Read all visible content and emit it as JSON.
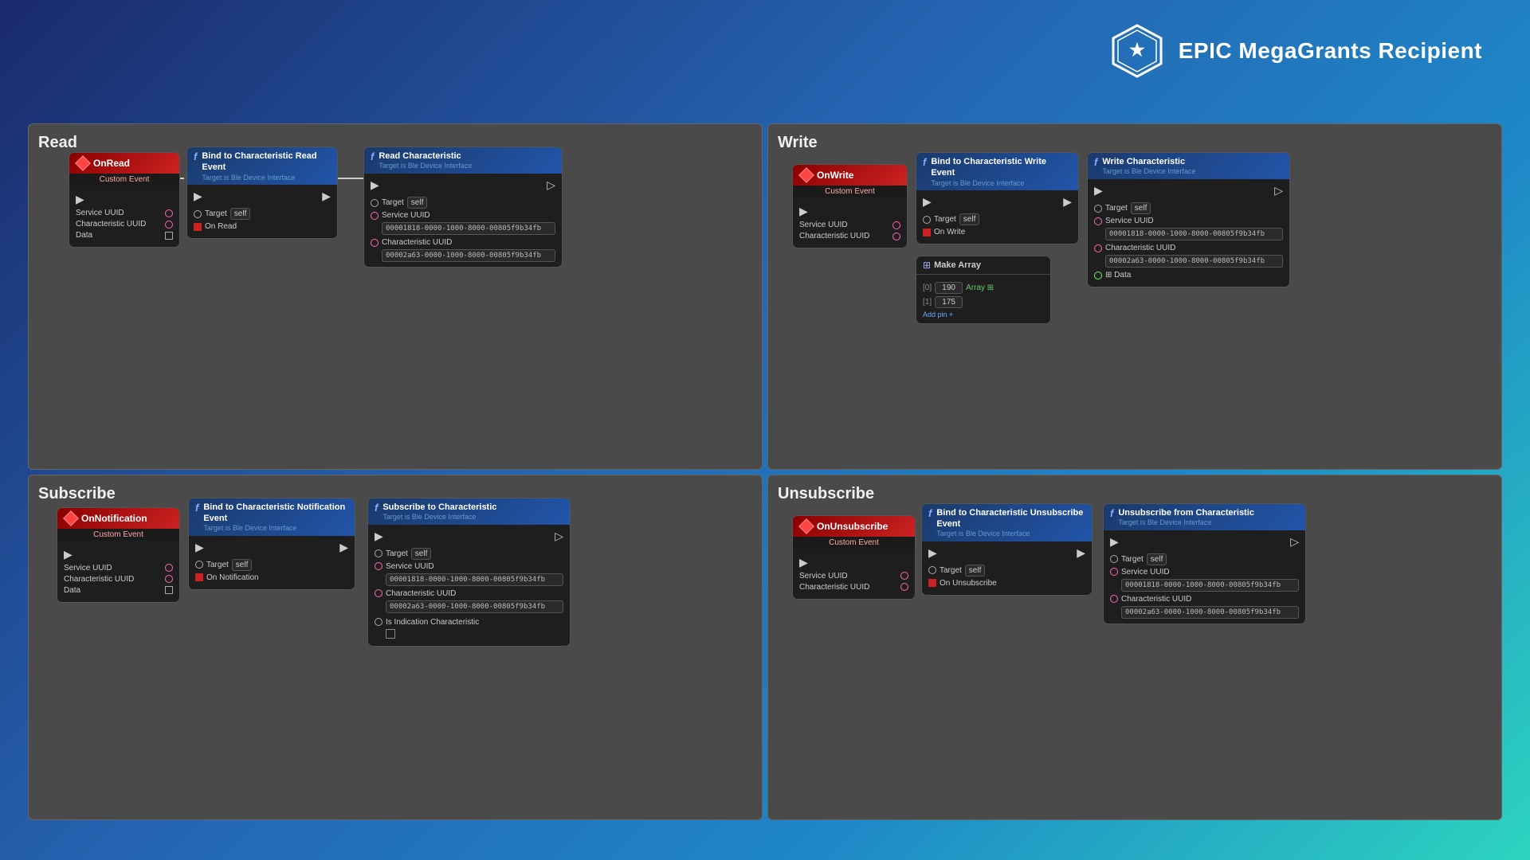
{
  "badge": {
    "title": "EPIC MegaGrants Recipient"
  },
  "panels": {
    "read": {
      "title": "Read",
      "onRead": {
        "event": "OnRead",
        "subtitle": "Custom Event",
        "pins": [
          "Service UUID",
          "Characteristic UUID",
          "Data"
        ]
      },
      "bindNode": {
        "title": "Bind to Characteristic Read Event",
        "subtitle": "Target is Ble Device Interface",
        "target": "self",
        "pins": [
          "On Read"
        ]
      },
      "readChar": {
        "title": "Read Characteristic",
        "subtitle": "Target is Ble Device Interface",
        "target": "self",
        "serviceUUID": "00001818-0000-1000-8000-00805f9b34fb",
        "charUUID": "00002a63-0000-1000-8000-00805f9b34fb"
      }
    },
    "write": {
      "title": "Write",
      "onWrite": {
        "event": "OnWrite",
        "subtitle": "Custom Event",
        "pins": [
          "Service UUID",
          "Characteristic UUID"
        ]
      },
      "bindNode": {
        "title": "Bind to Characteristic Write Event",
        "subtitle": "Target is Ble Device Interface",
        "target": "self",
        "pins": [
          "On Write"
        ]
      },
      "makeArray": {
        "title": "Make Array",
        "values": [
          "190",
          "175"
        ],
        "output": "Array"
      },
      "writeChar": {
        "title": "Write Characteristic",
        "subtitle": "Target is Ble Device Interface",
        "target": "self",
        "serviceUUID": "00001818-0000-1000-8000-00805f9b34fb",
        "charUUID": "00002a63-0000-1000-8000-00805f9b34fb",
        "dataPin": "Data"
      }
    },
    "subscribe": {
      "title": "Subscribe",
      "onNotification": {
        "event": "OnNotification",
        "subtitle": "Custom Event",
        "pins": [
          "Service UUID",
          "Characteristic UUID",
          "Data"
        ]
      },
      "bindNode": {
        "title": "Bind to Characteristic Notification Event",
        "subtitle": "Target is Ble Device Interface",
        "target": "self",
        "pins": [
          "On Notification"
        ]
      },
      "subscribeChar": {
        "title": "Subscribe to Characteristic",
        "subtitle": "Target is Ble Device Interface",
        "target": "self",
        "serviceUUID": "00001818-0000-1000-8000-00805f9b34fb",
        "charUUID": "00002a63-0000-1000-8000-00805f9b34fb",
        "isIndication": "Is Indication Characteristic"
      }
    },
    "unsubscribe": {
      "title": "Unsubscribe",
      "onUnsubscribe": {
        "event": "OnUnsubscribe",
        "subtitle": "Custom Event",
        "pins": [
          "Service UUID",
          "Characteristic UUID"
        ]
      },
      "bindNode": {
        "title": "Bind to Characteristic Unsubscribe Event",
        "subtitle": "Target is Ble Device Interface",
        "target": "self",
        "pins": [
          "On Unsubscribe"
        ]
      },
      "unsubscribeChar": {
        "title": "Unsubscribe from Characteristic",
        "subtitle": "Target is Ble Device Interface",
        "target": "self",
        "serviceUUID": "00001818-0000-1000-8000-00805f9b34fb",
        "charUUID": "00002a63-0000-1000-8000-00805f9b34fb"
      }
    }
  }
}
